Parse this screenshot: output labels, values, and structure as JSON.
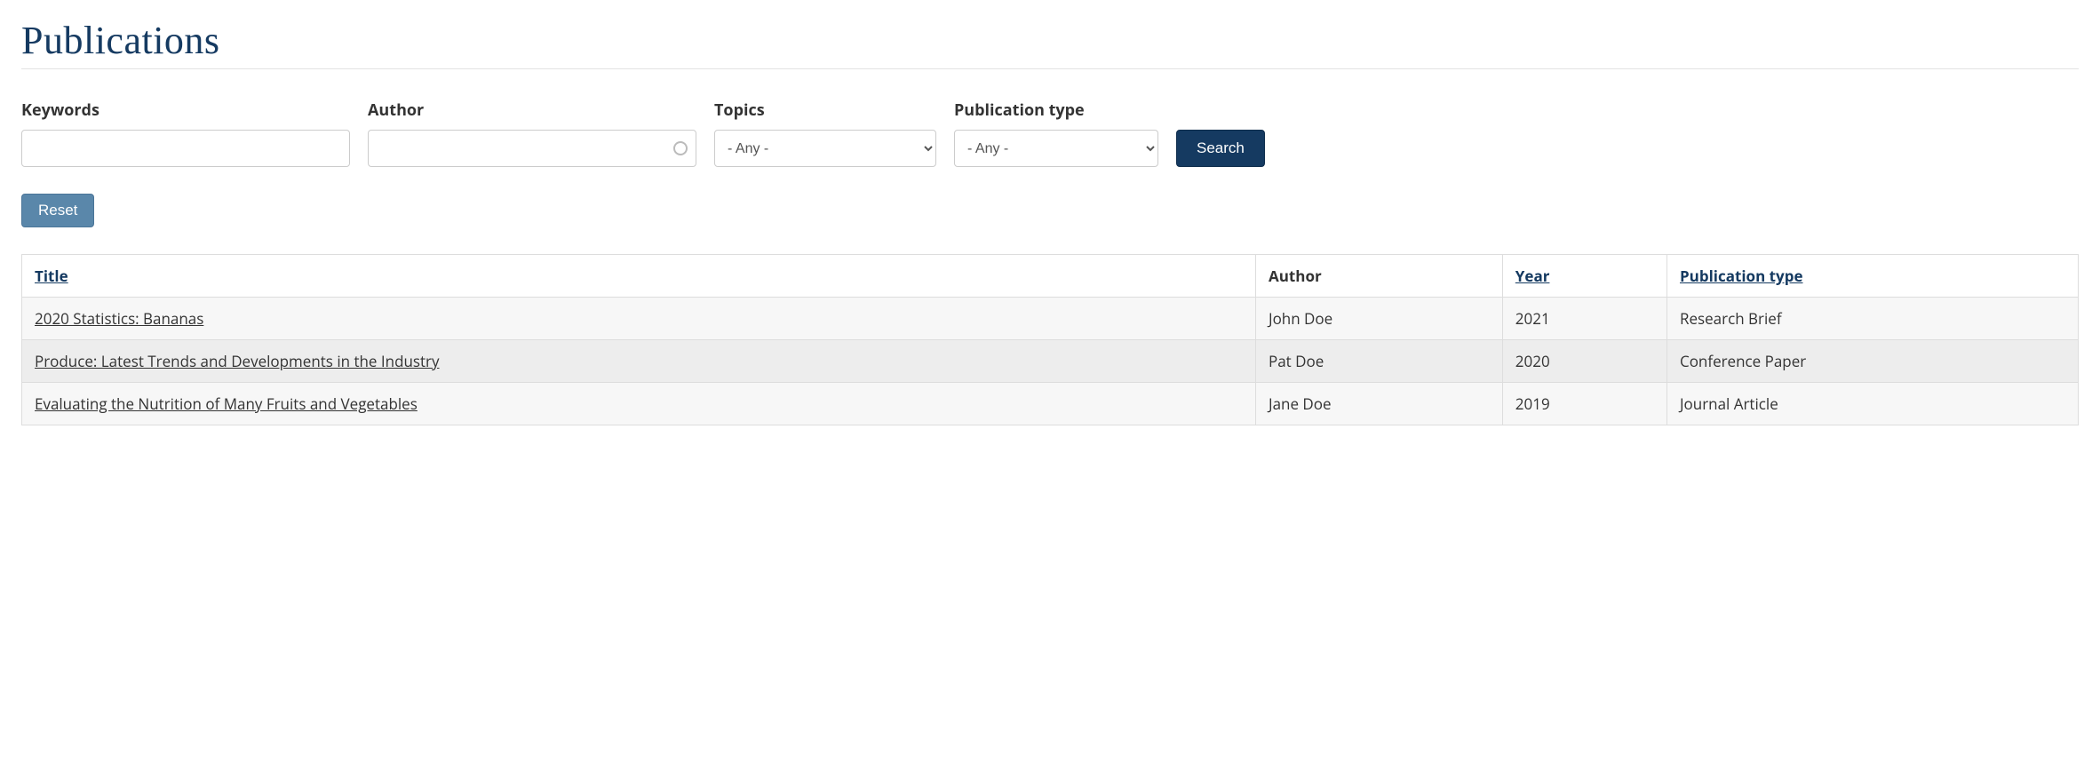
{
  "page": {
    "title": "Publications"
  },
  "filters": {
    "keywords": {
      "label": "Keywords",
      "value": ""
    },
    "author": {
      "label": "Author",
      "value": ""
    },
    "topics": {
      "label": "Topics",
      "selected": "- Any -"
    },
    "pubtype": {
      "label": "Publication type",
      "selected": "- Any -"
    },
    "search_label": "Search",
    "reset_label": "Reset"
  },
  "table": {
    "headers": {
      "title": "Title",
      "author": "Author",
      "year": "Year",
      "pubtype": "Publication type"
    },
    "rows": [
      {
        "title": "2020 Statistics: Bananas",
        "author": "John Doe",
        "year": "2021",
        "pubtype": "Research Brief"
      },
      {
        "title": "Produce: Latest Trends and Developments in the Industry",
        "author": "Pat Doe",
        "year": "2020",
        "pubtype": "Conference Paper"
      },
      {
        "title": "Evaluating the Nutrition of Many Fruits and Vegetables",
        "author": "Jane Doe",
        "year": "2019",
        "pubtype": "Journal Article"
      }
    ]
  }
}
